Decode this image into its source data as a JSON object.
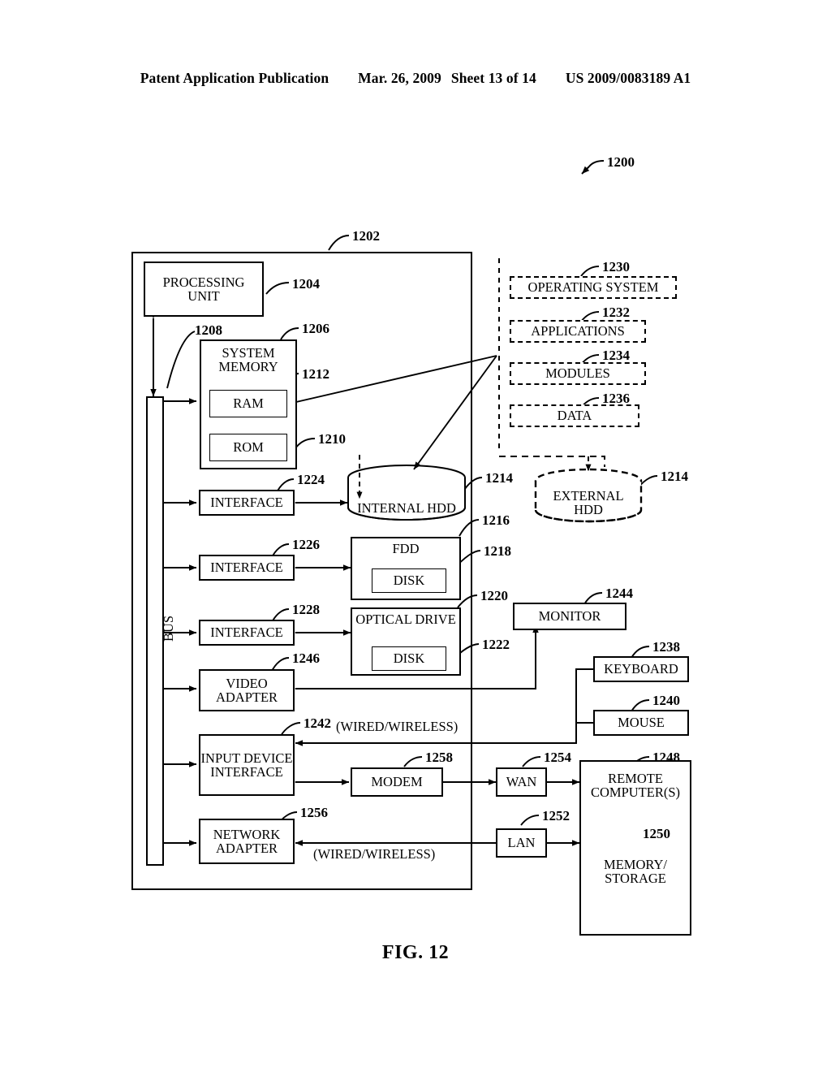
{
  "header": {
    "left": "Patent Application Publication",
    "date": "Mar. 26, 2009",
    "sheet": "Sheet 13 of 14",
    "pubnum": "US 2009/0083189 A1"
  },
  "figure": {
    "caption": "FIG. 12",
    "overall_ref": "1200"
  },
  "refs": {
    "r1200": "1200",
    "r1202": "1202",
    "r1204": "1204",
    "r1206": "1206",
    "r1208": "1208",
    "r1210": "1210",
    "r1212": "1212",
    "r1214a": "1214",
    "r1214b": "1214",
    "r1216": "1216",
    "r1218": "1218",
    "r1220": "1220",
    "r1222": "1222",
    "r1224": "1224",
    "r1226": "1226",
    "r1228": "1228",
    "r1230": "1230",
    "r1232": "1232",
    "r1234": "1234",
    "r1236": "1236",
    "r1238": "1238",
    "r1240": "1240",
    "r1242": "1242",
    "r1244": "1244",
    "r1246": "1246",
    "r1248": "1248",
    "r1250": "1250",
    "r1252": "1252",
    "r1254": "1254",
    "r1256": "1256",
    "r1258": "1258"
  },
  "blocks": {
    "processing_unit": "PROCESSING UNIT",
    "system_memory": "SYSTEM MEMORY",
    "ram": "RAM",
    "rom": "ROM",
    "bus": "BUS",
    "interface_hdd": "INTERFACE",
    "interface_fdd": "INTERFACE",
    "interface_optical": "INTERFACE",
    "internal_hdd": "INTERNAL HDD",
    "external_hdd": "EXTERNAL HDD",
    "fdd": "FDD",
    "fdd_disk": "DISK",
    "optical_drive": "OPTICAL DRIVE",
    "optical_disk": "DISK",
    "video_adapter": "VIDEO ADAPTER",
    "input_device_interface": "INPUT DEVICE INTERFACE",
    "network_adapter": "NETWORK ADAPTER",
    "modem": "MODEM",
    "wan": "WAN",
    "lan": "LAN",
    "monitor": "MONITOR",
    "keyboard": "KEYBOARD",
    "mouse": "MOUSE",
    "remote_computers": "REMOTE COMPUTER(S)",
    "memory_storage": "MEMORY/ STORAGE"
  },
  "software": {
    "operating_system": "OPERATING SYSTEM",
    "applications": "APPLICATIONS",
    "modules": "MODULES",
    "data": "DATA"
  },
  "annotations": {
    "wired_wireless_input": "(WIRED/WIRELESS)",
    "wired_wireless_network": "(WIRED/WIRELESS)"
  }
}
